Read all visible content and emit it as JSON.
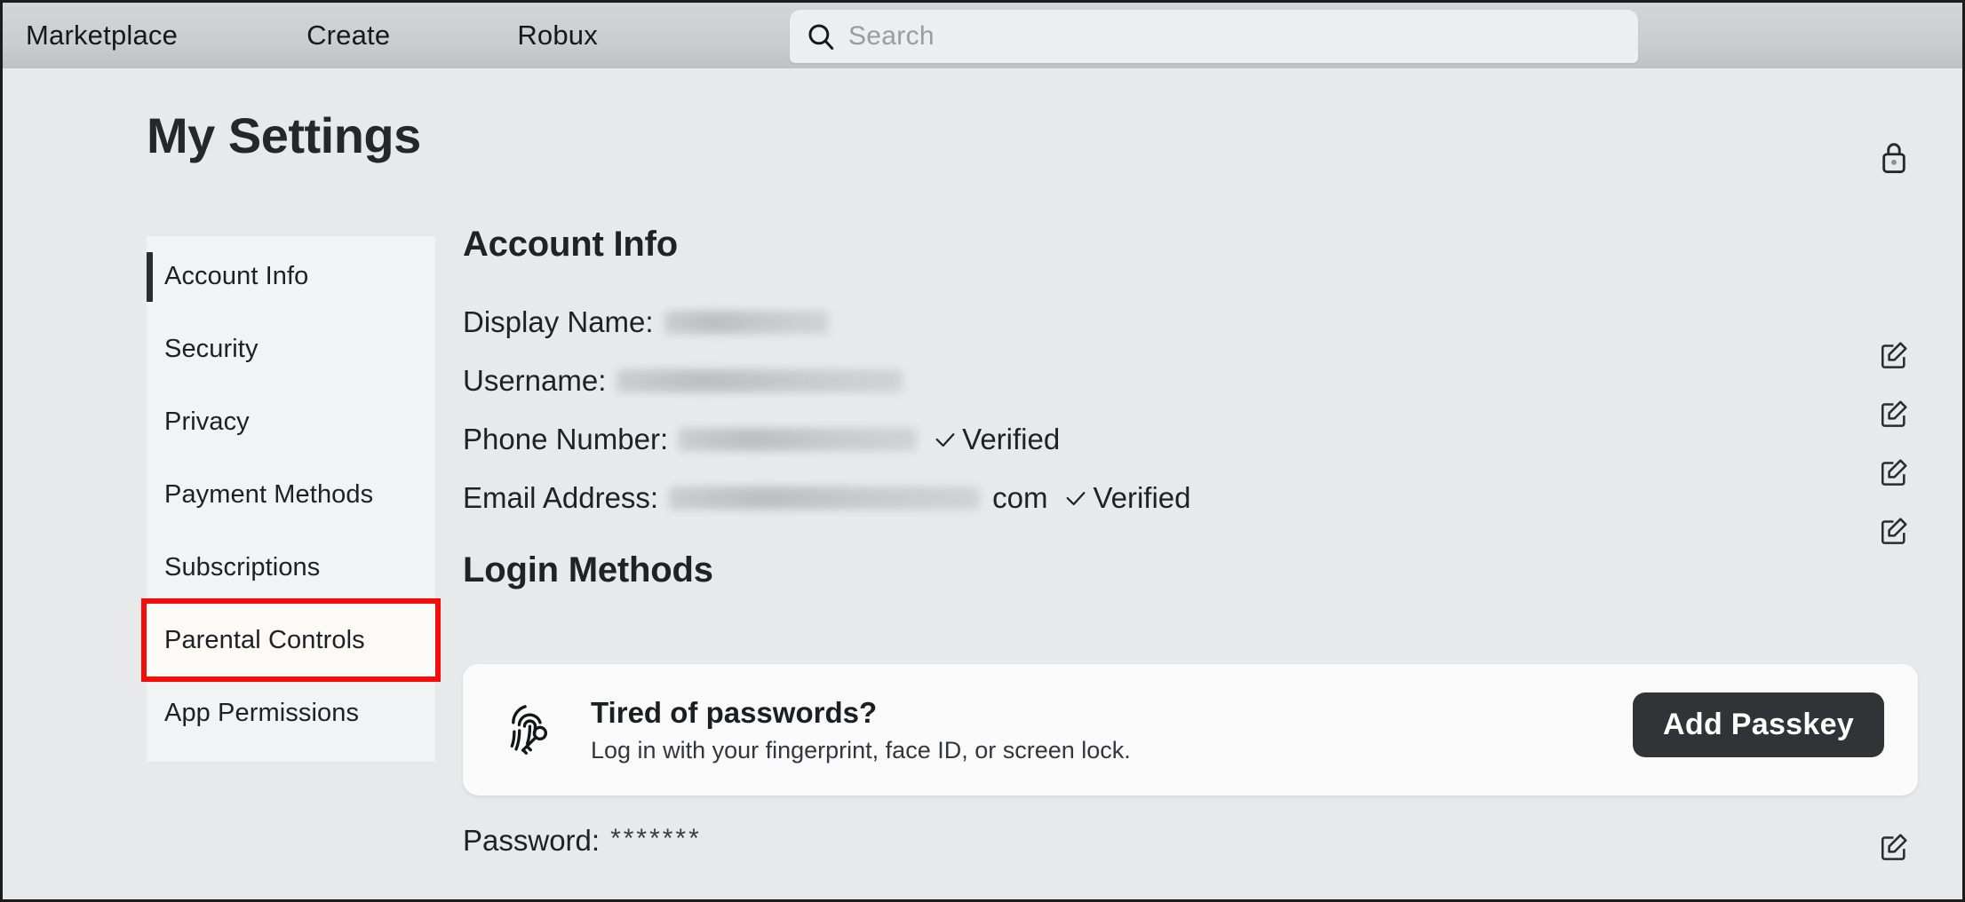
{
  "nav": {
    "links": [
      {
        "label": "Marketplace",
        "name": "nav-marketplace"
      },
      {
        "label": "Create",
        "name": "nav-create"
      },
      {
        "label": "Robux",
        "name": "nav-robux"
      }
    ],
    "search": {
      "placeholder": "Search",
      "value": "",
      "icon": "search-icon"
    }
  },
  "page": {
    "title": "My Settings",
    "lock_icon": "lock-icon"
  },
  "sidebar": {
    "items": [
      {
        "label": "Account Info",
        "active": true,
        "highlighted": false
      },
      {
        "label": "Security",
        "active": false,
        "highlighted": false
      },
      {
        "label": "Privacy",
        "active": false,
        "highlighted": false
      },
      {
        "label": "Payment Methods",
        "active": false,
        "highlighted": false
      },
      {
        "label": "Subscriptions",
        "active": false,
        "highlighted": false
      },
      {
        "label": "Parental Controls",
        "active": false,
        "highlighted": true
      },
      {
        "label": "App Permissions",
        "active": false,
        "highlighted": false
      }
    ],
    "highlight_color": "#f60b0b"
  },
  "account_info": {
    "heading": "Account Info",
    "rows": [
      {
        "label": "Display Name:",
        "value": "",
        "redacted": true,
        "redact_width": 185,
        "suffix": "",
        "verified": false,
        "verified_label": ""
      },
      {
        "label": "Username:",
        "value": "",
        "redacted": true,
        "redact_width": 322,
        "suffix": "",
        "verified": false,
        "verified_label": ""
      },
      {
        "label": "Phone Number:",
        "value": "",
        "redacted": true,
        "redact_width": 268,
        "suffix": "",
        "verified": true,
        "verified_label": "Verified"
      },
      {
        "label": "Email Address:",
        "value": "",
        "redacted": true,
        "redact_width": 350,
        "suffix": "com",
        "verified": true,
        "verified_label": "Verified"
      }
    ],
    "edit_icon": "edit-pencil-icon"
  },
  "login_methods": {
    "heading": "Login Methods",
    "passkey_card": {
      "icon": "fingerprint-key-icon",
      "title": "Tired of passwords?",
      "subtitle": "Log in with your fingerprint, face ID, or screen lock.",
      "button_label": "Add Passkey",
      "button_color": "#323336"
    },
    "password": {
      "label": "Password:",
      "masked_value": "*******",
      "edit_icon": "edit-pencil-icon"
    }
  }
}
